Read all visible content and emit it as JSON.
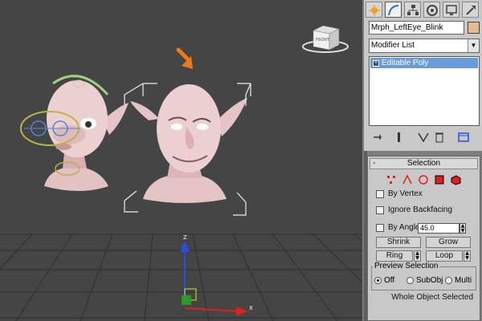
{
  "viewport": {
    "viewcube_label": "FRONT",
    "axis_labels": {
      "z": "Z",
      "x": "X"
    },
    "arrow_color": "#f07818",
    "grid_color": "#2e2e2e",
    "background": "#454545"
  },
  "command_panel": {
    "tabs": [
      "create-icon",
      "modify-icon",
      "hierarchy-icon",
      "motion-icon",
      "display-icon",
      "utilities-icon"
    ],
    "object_name": "Mrph_LeftEye_Blink",
    "object_color": "#e6b896",
    "modifier_list_label": "Modifier List",
    "stack_items": [
      "Editable Poly"
    ],
    "selection_rollout": {
      "title": "Selection",
      "by_vertex": "By Vertex",
      "ignore_backfacing": "Ignore Backfacing",
      "by_angle": "By Angle:",
      "by_angle_value": "45.0",
      "shrink": "Shrink",
      "grow": "Grow",
      "ring": "Ring",
      "loop": "Loop",
      "preview_selection": "Preview Selection",
      "preview_options": [
        "Off",
        "SubObj",
        "Multi"
      ],
      "preview_selected": "Off",
      "status": "Whole Object Selected"
    }
  }
}
